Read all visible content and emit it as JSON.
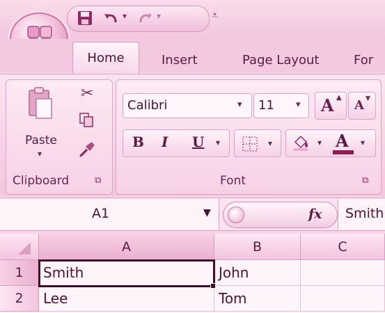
{
  "quick_access": {
    "icons": [
      "save-icon",
      "undo-icon",
      "redo-icon",
      "customize-icon"
    ]
  },
  "tabs": [
    "Home",
    "Insert",
    "Page Layout",
    "For"
  ],
  "clipboard": {
    "label": "Clipboard",
    "paste_label": "Paste"
  },
  "font": {
    "label": "Font",
    "family": "Calibri",
    "size": "11",
    "bold": "B",
    "italic": "I",
    "underline": "U",
    "grow": "A",
    "shrink": "A",
    "font_color": "A"
  },
  "formula_bar": {
    "name_box": "A1",
    "fx": "fx",
    "value": "Smith"
  },
  "sheet": {
    "columns": [
      "A",
      "B",
      "C"
    ],
    "rows": [
      {
        "num": "1",
        "cells": [
          "Smith",
          "John",
          ""
        ]
      },
      {
        "num": "2",
        "cells": [
          "Lee",
          "Tom",
          ""
        ]
      }
    ],
    "selected": "A1"
  },
  "colors": {
    "tint": "#f7d3e8",
    "accent": "#6a1e4b",
    "selection": "#3a0f28"
  }
}
